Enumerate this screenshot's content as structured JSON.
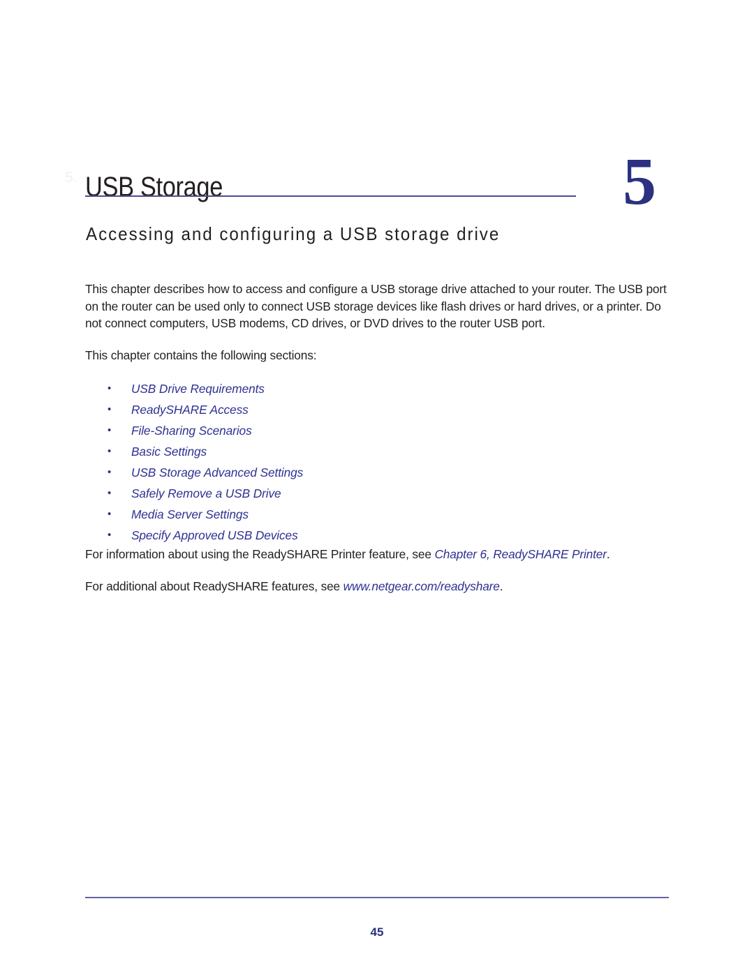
{
  "document": {
    "chapter_watermark": "5.",
    "chapter_title": "USB Storage",
    "chapter_subtitle": "Accessing and configuring a USB storage drive",
    "chapter_number": "5",
    "accent_color": "#2f3192",
    "rule_color": "#4c4c8f",
    "text_color": "#231f20"
  },
  "intro": {
    "paragraph_1": "This chapter describes how to access and configure a USB storage drive attached to your router. The USB port on the router can be used only to connect USB storage devices like flash drives or hard drives, or a printer. Do not connect computers, USB modems, CD drives, or DVD drives to the router USB port.",
    "paragraph_2": "This chapter contains the following sections:"
  },
  "sections": {
    "bullet": "•",
    "items": [
      {
        "label": "USB Drive Requirements"
      },
      {
        "label": "ReadySHARE Access"
      },
      {
        "label": "File-Sharing Scenarios"
      },
      {
        "label": "Basic Settings"
      },
      {
        "label": "USB Storage Advanced Settings"
      },
      {
        "label": "Safely Remove a USB Drive"
      },
      {
        "label": "Media Server Settings"
      },
      {
        "label": "Specify Approved USB Devices"
      }
    ]
  },
  "closing": {
    "printer_note_lead": "For information about using the ReadySHARE Printer feature, see ",
    "printer_note_link": "Chapter 6, ReadySHARE Printer",
    "printer_note_tail": ".",
    "web_note_lead": "For additional about ReadySHARE features, see ",
    "web_note_link": "www.netgear.com/readyshare",
    "web_note_tail": "."
  },
  "footer": {
    "page_number": "45"
  }
}
